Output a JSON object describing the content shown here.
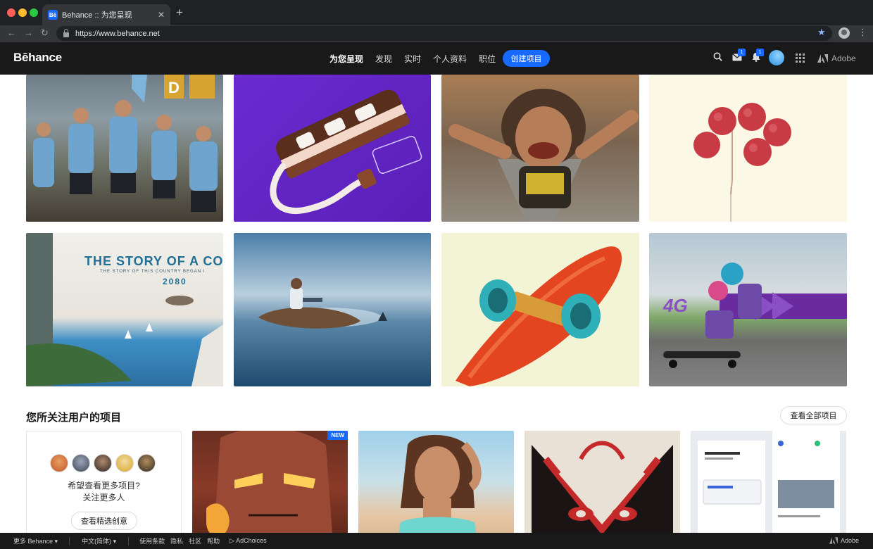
{
  "browser": {
    "tab_title": "Behance :: 为您呈现",
    "tab_favicon": "Bē",
    "url": "https://www.behance.net"
  },
  "header": {
    "logo": "Bēhance",
    "nav": [
      "为您呈现",
      "发现",
      "实时",
      "个人资料",
      "职位"
    ],
    "create_button": "创建项目",
    "message_count": "1",
    "notification_count": "1",
    "adobe_label": "Adobe"
  },
  "gallery": {
    "row2_text": {
      "title": "THE STORY OF A COU",
      "subtitle": "THE STORY OF THIS COUNTRY BEGAN I",
      "year": "2080"
    },
    "badge_4g": "4G"
  },
  "following": {
    "title": "您所关注用户的项目",
    "view_all": "查看全部项目",
    "prompt_line1": "希望查看更多项目?",
    "prompt_line2": "关注更多人",
    "curated_button": "查看精选创意",
    "new_badge": "NEW"
  },
  "footer": {
    "more": "更多 Behance",
    "language": "中文(简体)",
    "links": [
      "使用条款",
      "隐私",
      "社区",
      "帮助"
    ],
    "adchoices": "AdChoices",
    "adobe": "Adobe"
  },
  "colors": {
    "brand_blue": "#1769ff",
    "header_bg": "#191919"
  }
}
